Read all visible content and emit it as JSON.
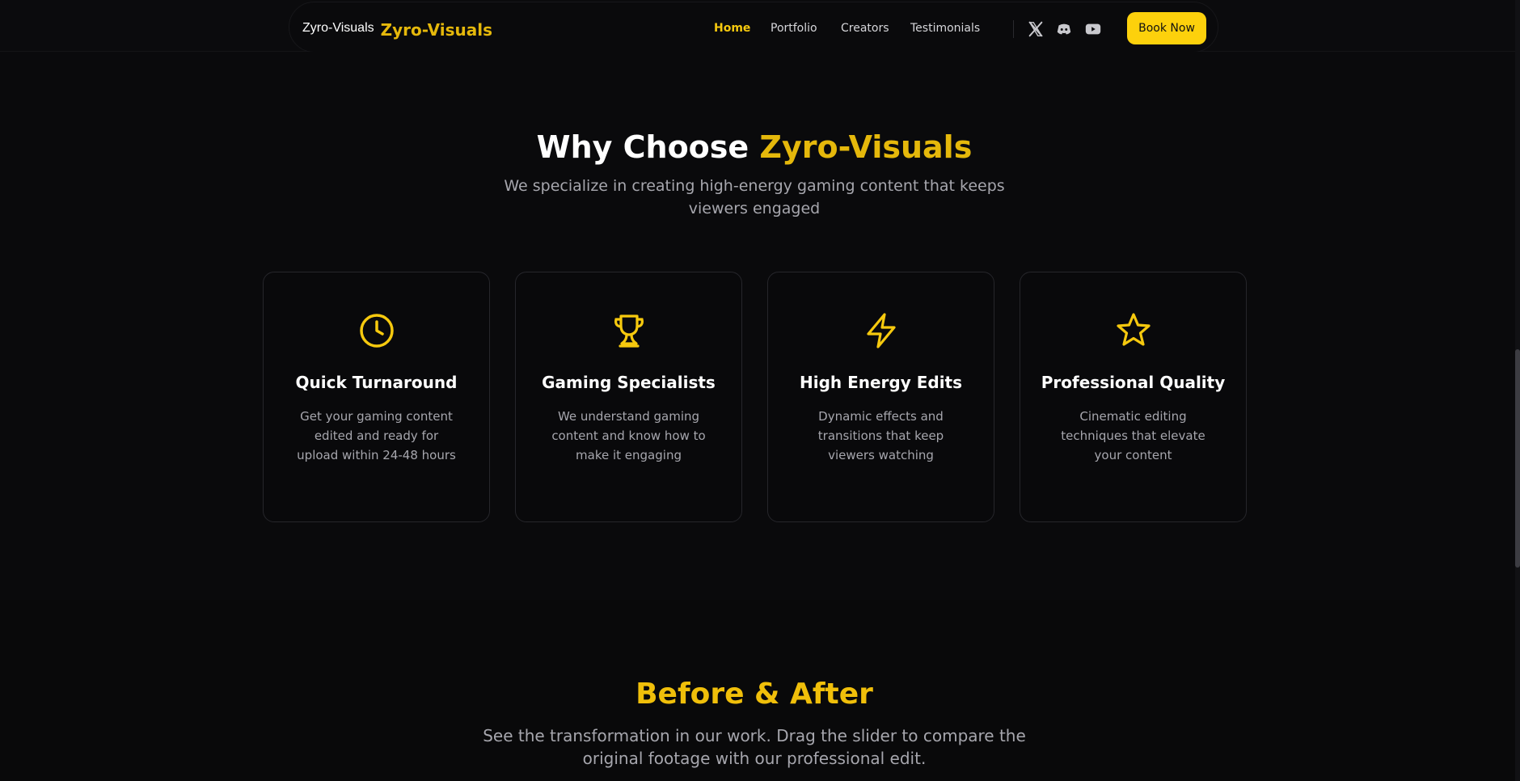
{
  "header": {
    "logo_alt": "Zyro-Visuals",
    "brand_name": "Zyro-Visuals",
    "nav": [
      {
        "label": "Home",
        "active": true
      },
      {
        "label": "Portfolio",
        "active": false
      },
      {
        "label": "Creators",
        "active": false
      },
      {
        "label": "Testimonials",
        "active": false
      }
    ],
    "social_icons": [
      "x-icon",
      "discord-icon",
      "youtube-icon"
    ],
    "cta_label": "Book Now"
  },
  "why_section": {
    "title_prefix": "Why Choose ",
    "title_accent": "Zyro-Visuals",
    "subtitle": "We specialize in creating high-energy gaming content that keeps viewers engaged",
    "features": [
      {
        "icon": "clock-icon",
        "title": "Quick Turnaround",
        "description": "Get your gaming content edited and ready for upload within 24-48 hours"
      },
      {
        "icon": "trophy-icon",
        "title": "Gaming Specialists",
        "description": "We understand gaming content and know how to make it engaging"
      },
      {
        "icon": "lightning-icon",
        "title": "High Energy Edits",
        "description": "Dynamic effects and transitions that keep viewers watching"
      },
      {
        "icon": "star-icon",
        "title": "Professional Quality",
        "description": "Cinematic editing techniques that elevate your content"
      }
    ]
  },
  "before_after": {
    "title": "Before & After",
    "subtitle": "See the transformation in our work. Drag the slider to compare the original footage with our professional edit."
  },
  "colors": {
    "accent": "#f6c90e",
    "background": "#0a0a0c",
    "muted_text": "#a6a6ad"
  }
}
